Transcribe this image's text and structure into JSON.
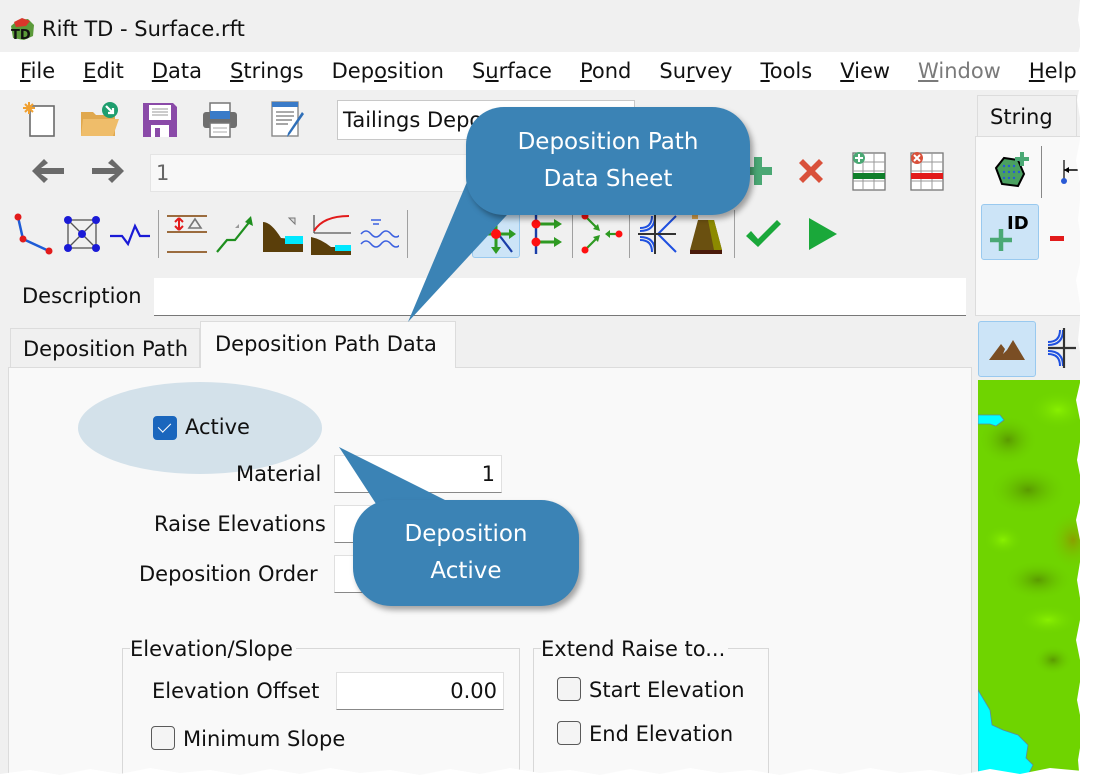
{
  "window": {
    "title": "Rift TD - Surface.rft",
    "app_icon": "rift-td-logo-icon"
  },
  "menu": [
    {
      "label": "File",
      "mnemonic_index": 0,
      "enabled": true
    },
    {
      "label": "Edit",
      "mnemonic_index": 0,
      "enabled": true
    },
    {
      "label": "Data",
      "mnemonic_index": 0,
      "enabled": true
    },
    {
      "label": "Strings",
      "mnemonic_index": 0,
      "enabled": true
    },
    {
      "label": "Deposition",
      "mnemonic_index": 3,
      "enabled": true
    },
    {
      "label": "Surface",
      "mnemonic_index": 1,
      "enabled": true
    },
    {
      "label": "Pond",
      "mnemonic_index": 0,
      "enabled": true
    },
    {
      "label": "Survey",
      "mnemonic_index": 2,
      "enabled": true
    },
    {
      "label": "Tools",
      "mnemonic_index": 0,
      "enabled": true
    },
    {
      "label": "View",
      "mnemonic_index": 0,
      "enabled": true
    },
    {
      "label": "Window",
      "mnemonic_index": 0,
      "enabled": false
    },
    {
      "label": "Help",
      "mnemonic_index": 0,
      "enabled": true
    }
  ],
  "toolbar1": {
    "icons": [
      "new-file-icon",
      "open-folder-icon",
      "save-icon",
      "print-icon",
      "edit-document-icon"
    ],
    "combo_value": "Tailings Deposition",
    "toggle_icon": "green-toggle-icon"
  },
  "toolbar2": {
    "back_icon": "arrow-left-icon",
    "forward_icon": "arrow-right-icon",
    "record_value": "1",
    "actions": [
      "add-icon",
      "delete-icon",
      "add-row-icon",
      "delete-row-icon"
    ]
  },
  "toolbar3": {
    "icons": [
      "polyline-icon",
      "mesh-icon",
      "profile-line-icon",
      "raise-elevation-icon",
      "slope-up-icon",
      "beach-slope-icon",
      "beach-curve-icon",
      "water-level-icon",
      "move-point-icon",
      "branch-points-icon",
      "merge-points-icon",
      "intersect-icon",
      "dam-icon",
      "validate-check-icon",
      "run-play-icon"
    ],
    "active": "move-point-icon"
  },
  "description": {
    "label": "Description",
    "value": ""
  },
  "tabs": [
    {
      "label": "Deposition Path",
      "active": false
    },
    {
      "label": "Deposition Path Data",
      "active": true
    }
  ],
  "form": {
    "active": {
      "label": "Active",
      "checked": true
    },
    "material": {
      "label": "Material",
      "value": "1"
    },
    "raise_elevations": {
      "label": "Raise Elevations",
      "value": ""
    },
    "deposition_order": {
      "label": "Deposition Order",
      "value": ""
    },
    "elevation_slope": {
      "title": "Elevation/Slope",
      "elevation_offset": {
        "label": "Elevation Offset",
        "value": "0.00"
      },
      "minimum_slope": {
        "label": "Minimum Slope",
        "checked": false
      }
    },
    "extend_raise": {
      "title": "Extend Raise to...",
      "start_elevation": {
        "label": "Start Elevation",
        "checked": false
      },
      "end_elevation": {
        "label": "End Elevation",
        "checked": false
      }
    }
  },
  "right_pane": {
    "tab_label": "String",
    "icons": [
      "add-polygon-icon",
      "string-direction-icon",
      "add-id-icon",
      "remove-icon",
      "terrain-icon",
      "intersect-icon"
    ]
  },
  "callouts": [
    {
      "text_line1": "Deposition Path",
      "text_line2": "Data Sheet"
    },
    {
      "text_line1": "Deposition",
      "text_line2": "Active"
    }
  ],
  "colors": {
    "callout": "#3b83b5",
    "highlight": "#d3e1ea",
    "checkbox_checked": "#1a66bd",
    "terrain_green": "#6fd400",
    "water": "#00ffff"
  }
}
